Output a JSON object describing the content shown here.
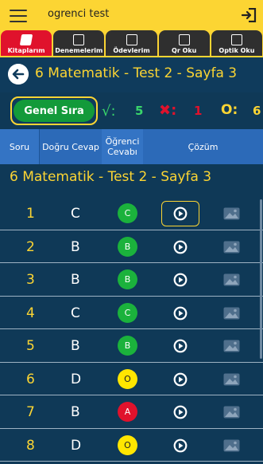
{
  "app": {
    "title": "ogrenci test"
  },
  "tabs": [
    {
      "label": "Kitaplarım",
      "active": true
    },
    {
      "label": "Denemelerim",
      "active": false
    },
    {
      "label": "Ödevlerim",
      "active": false
    },
    {
      "label": "Qr Oku",
      "active": false
    },
    {
      "label": "Optik Oku",
      "active": false
    }
  ],
  "header": {
    "subtitle": "6 Matematik - Test 2 - Sayfa 3"
  },
  "stats": {
    "genel_label": "Genel Sıra",
    "check_symbol": "√:",
    "correct": "5",
    "wrong_symbol": "✖:",
    "wrong": "1",
    "empty_symbol": "O:",
    "empty": "6"
  },
  "table": {
    "headers": [
      "Soru",
      "Doğru Cevap",
      "Öğrenci Cevabı",
      "Çözüm"
    ],
    "title": "6 Matematik - Test 2 - Sayfa 3",
    "rows": [
      {
        "no": "1",
        "correct": "C",
        "answer": "C",
        "status": "correct"
      },
      {
        "no": "2",
        "correct": "B",
        "answer": "B",
        "status": "correct"
      },
      {
        "no": "3",
        "correct": "B",
        "answer": "B",
        "status": "correct"
      },
      {
        "no": "4",
        "correct": "C",
        "answer": "C",
        "status": "correct"
      },
      {
        "no": "5",
        "correct": "B",
        "answer": "B",
        "status": "correct"
      },
      {
        "no": "6",
        "correct": "D",
        "answer": "O",
        "status": "empty"
      },
      {
        "no": "7",
        "correct": "B",
        "answer": "A",
        "status": "wrong"
      },
      {
        "no": "8",
        "correct": "D",
        "answer": "O",
        "status": "empty"
      }
    ]
  },
  "colors": {
    "accent": "#fcd533",
    "background": "#0f3957",
    "correct": "#1bb23c",
    "wrong": "#e0122c",
    "empty": "#ffe600"
  },
  "icons": {
    "menu": "menu-icon",
    "logout": "logout-icon",
    "back": "back-arrow-icon",
    "play": "play-circle-icon",
    "image": "image-icon"
  }
}
